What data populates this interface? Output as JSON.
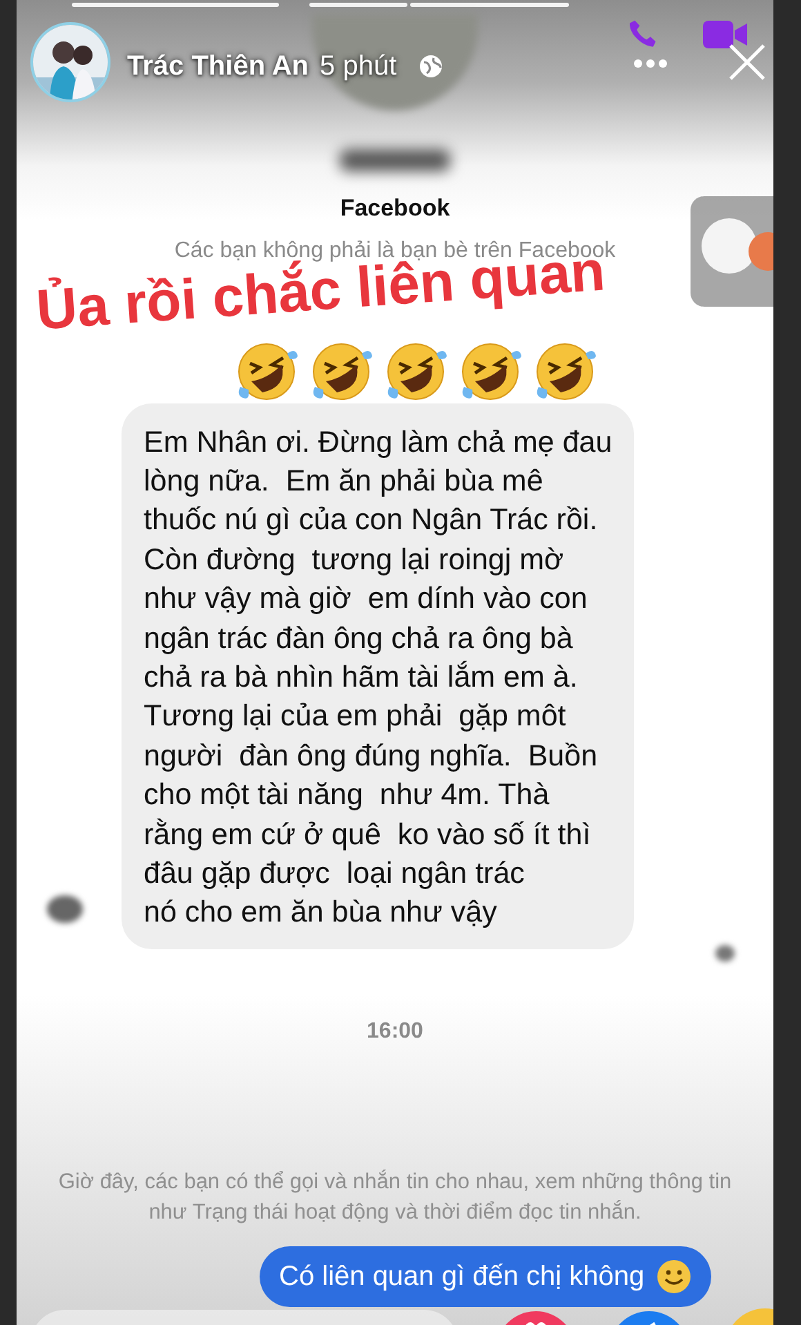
{
  "story": {
    "author": "Trác Thiên An",
    "time": "5 phút"
  },
  "chat": {
    "title": "Facebook",
    "note": "Các bạn không phải là bạn bè trên Facebook",
    "incoming": "Em Nhân ơi. Đừng làm chả mẹ đau\nlòng nữa.  Em ăn phải bùa mê\nthuốc nú gì của con Ngân Trác rồi.\nCòn đường  tương lại roingj mờ\nnhư vậy mà giờ  em dính vào con\nngân trác đàn ông chả ra ông bà\nchả ra bà nhìn hãm tài lắm em à.\nTương lại của em phải  gặp môt\nngười  đàn ông đúng nghĩa.  Buồn\ncho một tài năng  như 4m. Thà\nrằng em cứ ở quê  ko vào số ít thì\nđâu gặp được  loại ngân trác\nnó cho em ăn bùa như vậy",
    "time": "16:00",
    "notice": "Giờ đây, các bạn có thể gọi và nhắn tin cho nhau, xem những thông tin như Trạng thái hoạt động và thời điểm đọc tin nhắn.",
    "outgoing": "Có liên quan gì đến chị không"
  },
  "sticker": "Ủa rồi chắc liên quan"
}
